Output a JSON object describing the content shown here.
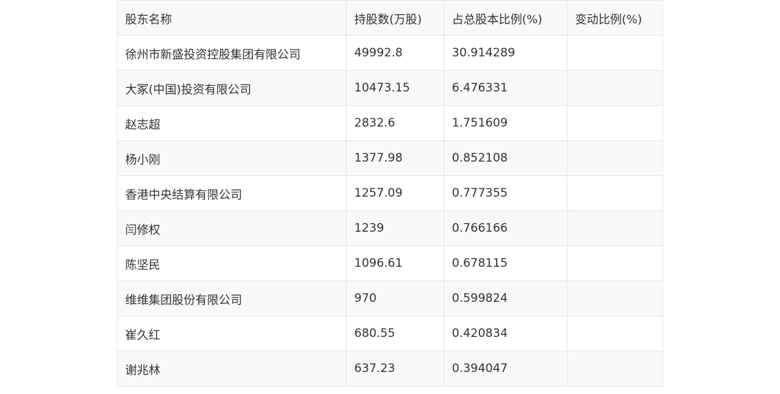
{
  "table": {
    "headers": [
      "股东名称",
      "持股数(万股)",
      "占总股本比例(%)",
      "变动比例(%)"
    ],
    "rows": [
      [
        "徐州市新盛投资控股集团有限公司",
        "49992.8",
        "30.914289",
        ""
      ],
      [
        "大冢(中国)投资有限公司",
        "10473.15",
        "6.476331",
        ""
      ],
      [
        "赵志超",
        "2832.6",
        "1.751609",
        ""
      ],
      [
        "杨小刚",
        "1377.98",
        "0.852108",
        ""
      ],
      [
        "香港中央结算有限公司",
        "1257.09",
        "0.777355",
        ""
      ],
      [
        "闫修权",
        "1239",
        "0.766166",
        ""
      ],
      [
        "陈坚民",
        "1096.61",
        "0.678115",
        ""
      ],
      [
        "维维集团股份有限公司",
        "970",
        "0.599824",
        ""
      ],
      [
        "崔久红",
        "680.55",
        "0.420834",
        ""
      ],
      [
        "谢兆林",
        "637.23",
        "0.394047",
        ""
      ]
    ]
  }
}
